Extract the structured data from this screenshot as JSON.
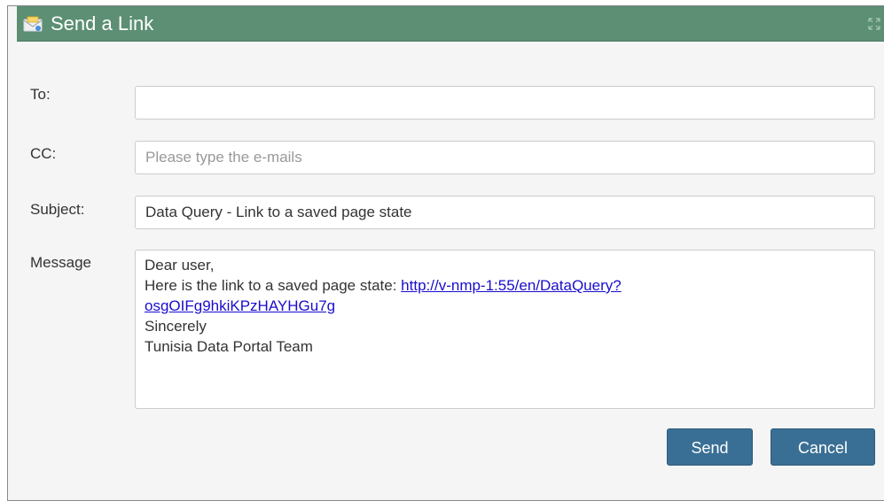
{
  "dialog": {
    "title": "Send a Link",
    "header_icon": "envelope-icon",
    "resize_icon": "resize-arrows-icon",
    "header_color": "#5c8f73"
  },
  "form": {
    "to_label": "To:",
    "to_value": "",
    "cc_label": "CC:",
    "cc_placeholder": "Please type the e-mails",
    "subject_label": "Subject:",
    "subject_value": "Data Query - Link to a saved page state",
    "message_label": "Message",
    "message": {
      "greeting": "Dear user,",
      "link_intro": "Here is the link to a saved page state: ",
      "link_line1": "http://v-nmp-1:55/en/DataQuery?",
      "link_line2": "osgOIFg9hkiKPzHAYHGu7g",
      "closing": "Sincerely",
      "signature": "Tunisia Data Portal Team"
    }
  },
  "buttons": {
    "send_label": "Send",
    "cancel_label": "Cancel",
    "button_color": "#3a6f95"
  }
}
